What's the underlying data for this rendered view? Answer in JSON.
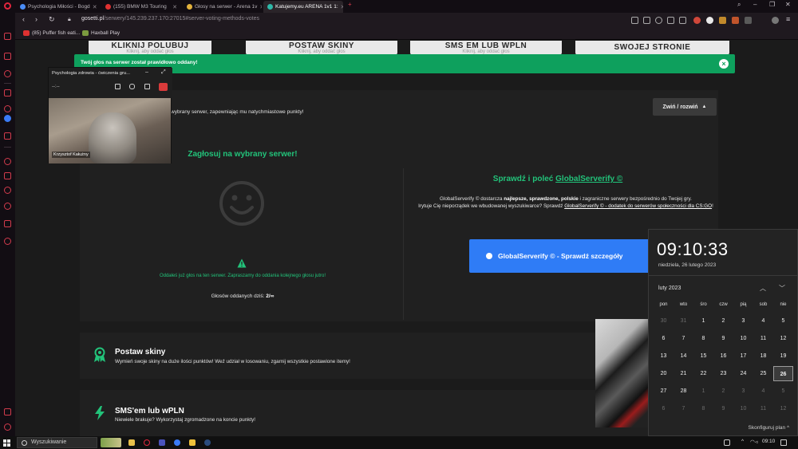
{
  "tabs": [
    {
      "label": "Psychologia Miłości - Bogd",
      "color": "#4a8cf6",
      "active": false
    },
    {
      "label": "(155) BMW M3 Touring",
      "color": "#e03131",
      "active": false
    },
    {
      "label": "Głosy na serwer - Arena 1v",
      "color": "#e3b23c",
      "active": false
    },
    {
      "label": "Katujemy.eu ARENA 1v1 1:",
      "color": "#2eb8a8",
      "active": true
    }
  ],
  "address": {
    "host": "gosetti.pl",
    "path": "/serwery/145.239.237.170:27015#server-voting-methods-votes"
  },
  "bookmarks": [
    {
      "label": "(85) Puffer fish eati...",
      "color": "#e03131"
    },
    {
      "label": "Haxball Play",
      "color": "#7b9a3f"
    }
  ],
  "top_cards": [
    {
      "title": "KLIKNIJ POLUBUJ",
      "sub": "Kliknij, aby oddać głos"
    },
    {
      "title": "POSTAW SKINY",
      "sub": "Kliknij, aby oddać głos"
    },
    {
      "title": "SMS EM LUB WPLN",
      "sub": "Kliknij, aby oddać głos"
    },
    {
      "title": "SWOJEJ STRONIE",
      "sub": ""
    }
  ],
  "toast": {
    "message": "Twój głos na serwer został prawidłowo oddany!",
    "close": "×"
  },
  "vote_section": {
    "description": "wybrany serwer, zapewniając mu natychmiastowe punkty!",
    "toggle_label": "Zwiń / rozwiń",
    "title": "Zagłosuj na wybrany serwer!",
    "voted_msg": "Oddałeś już głos na ten serwer. Zapraszamy do oddania kolejnego głosu jutro!",
    "count_label": "Głosów oddanych dziś:",
    "count_value": "2/∞"
  },
  "globalserverify": {
    "title_prefix": "Sprawdź i poleć",
    "title_link": "GlobalServerify ©",
    "desc_1": "GlobalServerify © dostarcza",
    "desc_bold": "najlepsze, sprawdzone, polskie",
    "desc_2": "i zagraniczne serwery bezpośrednio do Twojej gry.",
    "desc_3": "Irytuje Cię nieporządek we wbudowanej wyszukiwarce? Sprawdź",
    "desc_link": "GlobalServerify © - dodatek do serwerów społeczności dla CS:GO",
    "desc_end": "!",
    "button": "GlobalServerify © - Sprawdź szczegóły"
  },
  "features": [
    {
      "title": "Postaw skiny",
      "desc": "Wymień swoje skiny na duże ilości punktów! Weź udział w losowaniu, zgarnij wszystkie postawione itemy!"
    },
    {
      "title": "SMS'em lub wPLN",
      "desc": "Niewiele brakuje? Wykorzystaj zgromadzone na koncie punkty!"
    }
  ],
  "video_call": {
    "title": "Psychologia zdrowia - ćwiczenia gru...",
    "timer": "--:--",
    "participant": "Krzysztof Kałużny"
  },
  "calendar": {
    "time": "09:10:33",
    "date": "niedziela, 26 lutego 2023",
    "month": "luty 2023",
    "weekdays": [
      "pon",
      "wto",
      "śro",
      "czw",
      "pią",
      "sob",
      "nie"
    ],
    "days": [
      [
        "30",
        "31",
        "1",
        "2",
        "3",
        "4",
        "5"
      ],
      [
        "6",
        "7",
        "8",
        "9",
        "10",
        "11",
        "12"
      ],
      [
        "13",
        "14",
        "15",
        "16",
        "17",
        "18",
        "19"
      ],
      [
        "20",
        "21",
        "22",
        "23",
        "24",
        "25",
        "26"
      ],
      [
        "27",
        "28",
        "1",
        "2",
        "3",
        "4",
        "5"
      ],
      [
        "6",
        "7",
        "8",
        "9",
        "10",
        "11",
        "12"
      ]
    ],
    "today": "26",
    "plan_label": "Skonfiguruj plan"
  },
  "taskbar": {
    "search": "Wyszukiwanie",
    "clock": "09:10"
  }
}
